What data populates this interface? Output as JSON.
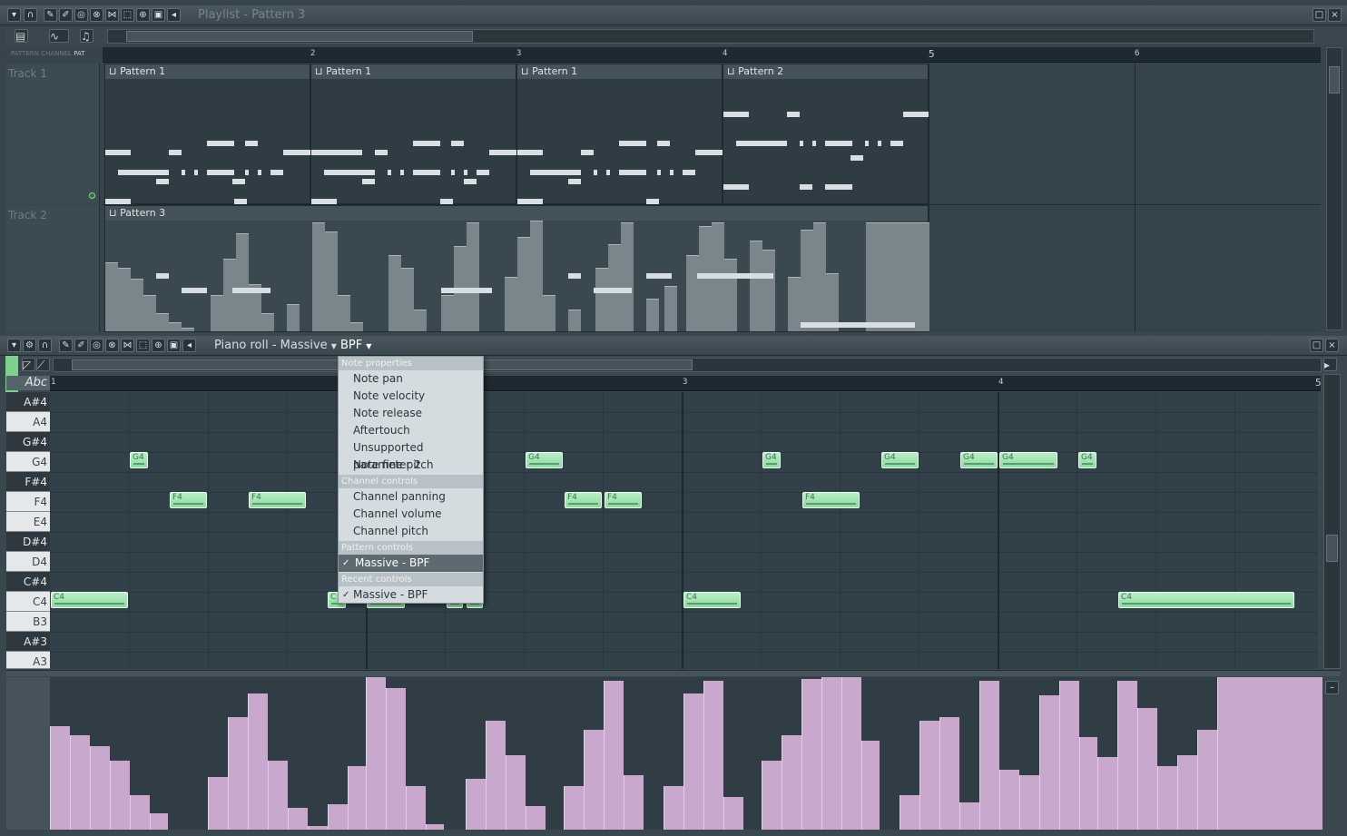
{
  "playlist": {
    "title": "Playlist - Pattern 3",
    "ruler": [
      "2",
      "3",
      "4",
      "5",
      "6"
    ],
    "tracks": [
      {
        "name": "Track 1"
      },
      {
        "name": "Track 2"
      }
    ],
    "clips": [
      "Pattern 1",
      "Pattern 1",
      "Pattern 1",
      "Pattern 2",
      "Pattern 3"
    ],
    "snap_labels": [
      "PATTERN",
      "CHANNEL",
      "PAT"
    ]
  },
  "pianoroll": {
    "title": "Piano roll - Massive",
    "target": "BPF",
    "abc_label": "Abc",
    "ruler": [
      "1",
      "3",
      "4",
      "5"
    ],
    "keys": [
      "A#4",
      "A4",
      "G#4",
      "G4",
      "F#4",
      "F4",
      "E4",
      "D#4",
      "D4",
      "C#4",
      "C4",
      "B3",
      "A#3",
      "A3"
    ],
    "notes": [
      {
        "label": "G4"
      },
      {
        "label": "G4"
      },
      {
        "label": "G4"
      },
      {
        "label": "G4"
      },
      {
        "label": "G4"
      },
      {
        "label": "G4"
      },
      {
        "label": "G4"
      },
      {
        "label": "F4"
      },
      {
        "label": "F4"
      },
      {
        "label": "F4"
      },
      {
        "label": "F4"
      },
      {
        "label": "F4"
      },
      {
        "label": "C4"
      },
      {
        "label": "C"
      },
      {
        "label": "C4"
      },
      {
        "label": "C4"
      }
    ]
  },
  "dropdown": {
    "sections": [
      {
        "header": "Note properties",
        "items": [
          "Note pan",
          "Note velocity",
          "Note release",
          "Aftertouch",
          "Unsupported parameter 2",
          "Note fine pitch"
        ]
      },
      {
        "header": "Channel controls",
        "items": [
          "Channel panning",
          "Channel volume",
          "Channel pitch"
        ]
      },
      {
        "header": "Pattern controls",
        "items": [
          "Massive - BPF"
        ]
      },
      {
        "header": "Recent controls",
        "items": [
          "Massive - BPF"
        ]
      }
    ],
    "checked_mark": "✓"
  },
  "colors": {
    "note": "#a8e6b8",
    "event": "#c8a8cc",
    "bg": "#324049"
  }
}
